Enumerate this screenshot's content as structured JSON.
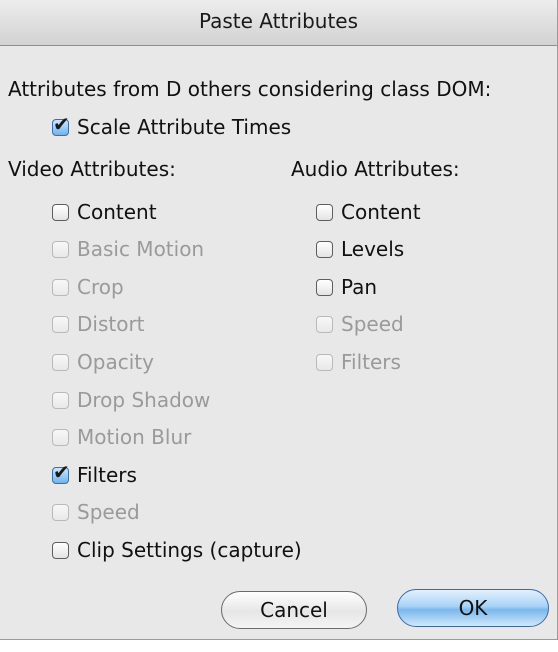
{
  "dialog": {
    "title": "Paste Attributes",
    "header_text": "Attributes from D others considering class DOM:",
    "scale_attribute_times": {
      "label": "Scale Attribute Times",
      "checked": true
    }
  },
  "video": {
    "heading": "Video Attributes:",
    "items": [
      {
        "label": "Content",
        "checked": false,
        "enabled": true
      },
      {
        "label": "Basic Motion",
        "checked": false,
        "enabled": false
      },
      {
        "label": "Crop",
        "checked": false,
        "enabled": false
      },
      {
        "label": "Distort",
        "checked": false,
        "enabled": false
      },
      {
        "label": "Opacity",
        "checked": false,
        "enabled": false
      },
      {
        "label": "Drop Shadow",
        "checked": false,
        "enabled": false
      },
      {
        "label": "Motion Blur",
        "checked": false,
        "enabled": false
      },
      {
        "label": "Filters",
        "checked": true,
        "enabled": true
      },
      {
        "label": "Speed",
        "checked": false,
        "enabled": false
      },
      {
        "label": "Clip Settings (capture)",
        "checked": false,
        "enabled": true
      }
    ]
  },
  "audio": {
    "heading": "Audio Attributes:",
    "items": [
      {
        "label": "Content",
        "checked": false,
        "enabled": true
      },
      {
        "label": "Levels",
        "checked": false,
        "enabled": true
      },
      {
        "label": "Pan",
        "checked": false,
        "enabled": true
      },
      {
        "label": "Speed",
        "checked": false,
        "enabled": false
      },
      {
        "label": "Filters",
        "checked": false,
        "enabled": false
      }
    ]
  },
  "buttons": {
    "cancel_label": "Cancel",
    "ok_label": "OK"
  },
  "icons": {
    "checkmark_glyph": "✔"
  },
  "colors": {
    "default_button": "#7ab8ec",
    "disabled_text": "#9a9a9a",
    "dialog_background": "#e8e8e8"
  }
}
